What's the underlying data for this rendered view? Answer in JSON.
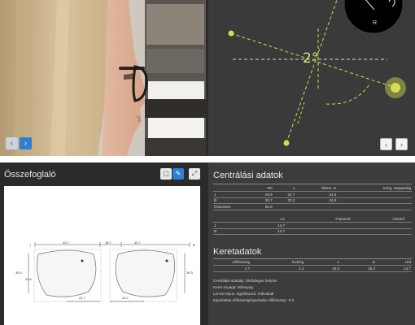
{
  "camera_panel": {
    "prev_icon": "chevron-left-icon",
    "next_icon": "chevron-right-icon"
  },
  "angle_panel": {
    "angle_value": "2°",
    "pad_label": "R",
    "prev_icon": "chevron-left-icon",
    "next_icon": "chevron-right-icon",
    "colors": {
      "accent": "#d4dd4f",
      "background": "#3a3a3a"
    }
  },
  "summary": {
    "title": "Összefoglaló",
    "toolbar": {
      "left_icon": "square-icon",
      "middle_icon": "pencil-icon",
      "right_icon": "expand-icon"
    },
    "diagram": {
      "right_lens_label": "J",
      "left_lens_label": "B",
      "top_dims": [
        "40.7",
        "18.7",
        "40.7"
      ],
      "side_dims": [
        "36.3",
        "24.6",
        "36.3"
      ],
      "bottom_dims": [
        "22.7",
        "23.2"
      ]
    }
  },
  "centering": {
    "title": "Centrálási adatok",
    "table1": {
      "headers": [
        "",
        "PD",
        "γ",
        "Illeszt. m",
        "Szög. Magasság"
      ],
      "rows": [
        [
          "J",
          "29.9",
          "22.7",
          "24.6",
          ""
        ],
        [
          "B",
          "30.7",
          "23.2",
          "24.9",
          ""
        ],
        [
          "Összesen",
          "60.6",
          "",
          "",
          ""
        ]
      ]
    },
    "table2": {
      "headers": [
        "",
        "LC",
        "FrameFit",
        "Átmérő"
      ],
      "rows": [
        [
          "J",
          "13.7",
          "",
          ""
        ],
        [
          "B",
          "13.7",
          "",
          ""
        ]
      ]
    }
  },
  "frame": {
    "title": "Keretadatok",
    "table": {
      "headers": [
        "Dőlésszög",
        "Ívelség",
        "A",
        "B",
        "Híd"
      ],
      "row": [
        "1.7",
        "2.3",
        "49.4",
        "36.3",
        "14.7"
      ]
    },
    "info": [
      "Centrálási szabály: Elsődleges helyzet",
      "Keret anyaga: Műanyag",
      "Lencse típus: Egyfókuszú: Individual",
      "Kijavítatlan dőlésszögKijavítatlan dőlésszög: -0.3"
    ]
  }
}
